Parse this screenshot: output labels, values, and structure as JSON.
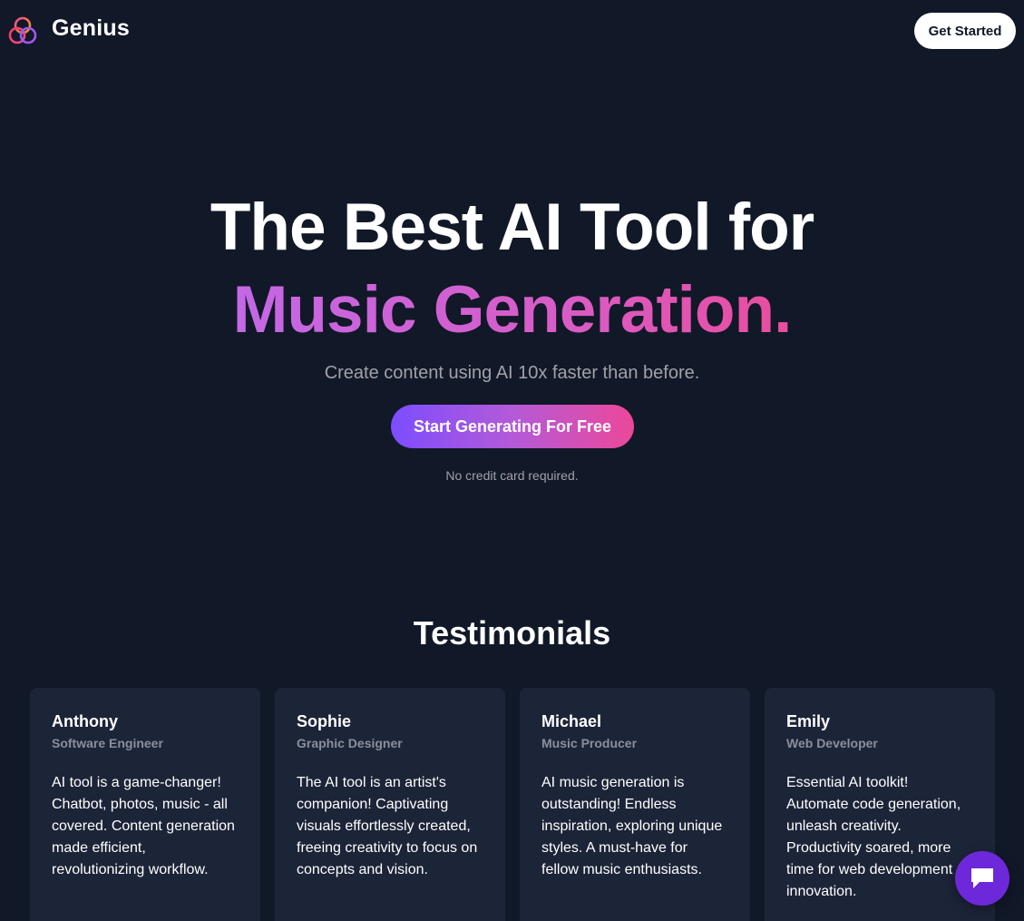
{
  "nav": {
    "brand": "Genius",
    "logo_icon": "three-rings-logo-icon",
    "get_started_label": "Get Started"
  },
  "hero": {
    "line1": "The Best AI Tool for",
    "line2": "Music Generation.",
    "subtitle": "Create content using AI 10x faster than before.",
    "cta_label": "Start Generating For Free",
    "note": "No credit card required."
  },
  "testimonials": {
    "heading": "Testimonials",
    "items": [
      {
        "name": "Anthony",
        "role": "Software Engineer",
        "quote": "AI tool is a game-changer! Chatbot, photos, music - all covered. Content generation made efficient, revolutionizing workflow."
      },
      {
        "name": "Sophie",
        "role": "Graphic Designer",
        "quote": "The AI tool is an artist's companion! Captivating visuals effortlessly created, freeing creativity to focus on concepts and vision."
      },
      {
        "name": "Michael",
        "role": "Music Producer",
        "quote": "AI music generation is outstanding! Endless inspiration, exploring unique styles. A must-have for fellow music enthusiasts."
      },
      {
        "name": "Emily",
        "role": "Web Developer",
        "quote": "Essential AI toolkit! Automate code generation, unleash creativity. Productivity soared, more time for web development innovation."
      }
    ]
  },
  "chat_widget": {
    "icon": "chat-bubble-icon"
  },
  "colors": {
    "background": "#111827",
    "card": "#1c2438",
    "gradient_start": "#7c4dff",
    "gradient_end": "#ec4899",
    "chat": "#6d28d9"
  }
}
